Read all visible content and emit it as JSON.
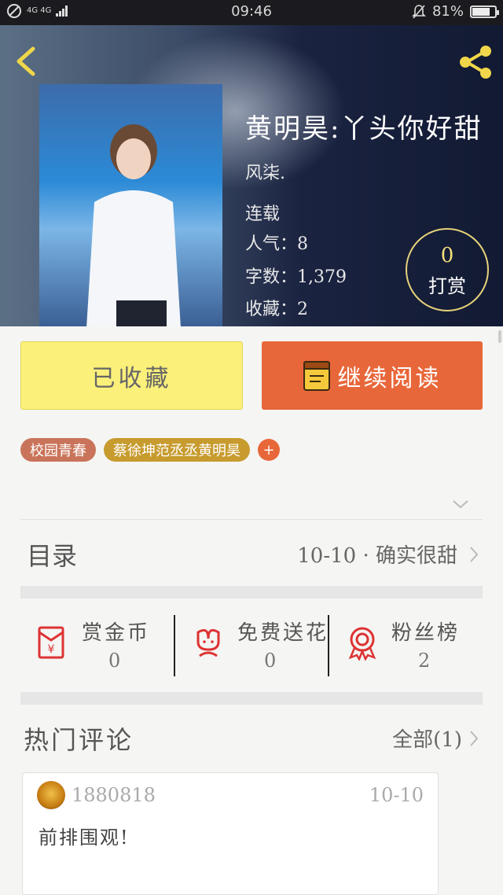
{
  "status_bar": {
    "network": "4G 4G",
    "time": "09:46",
    "battery": "81%",
    "battery_level": 0.81
  },
  "book": {
    "title": "黄明昊:丫头你好甜",
    "author": "风柒.",
    "status": "连载",
    "popularity": "人气：8",
    "word_count": "字数：1,379",
    "favorites": "收藏：2",
    "tip_count": "0",
    "tip_label": "打赏"
  },
  "actions": {
    "collected_label": "已收藏",
    "continue_label": "继续阅读"
  },
  "tags": {
    "items": [
      "校园青春",
      "蔡徐坤范丞丞黄明昊"
    ],
    "add": "+"
  },
  "catalog": {
    "label": "目录",
    "latest": "10-10 · 确实很甜"
  },
  "stats": {
    "gold": {
      "label": "赏金币",
      "value": "0"
    },
    "flowers": {
      "label": "免费送花",
      "value": "0"
    },
    "fans": {
      "label": "粉丝榜",
      "value": "2"
    }
  },
  "comments": {
    "title": "热门评论",
    "all_label": "全部(1)",
    "items": [
      {
        "user": "1880818",
        "date": "10-10",
        "text": "前排围观!"
      }
    ]
  },
  "colors": {
    "primary": "#e8673a",
    "collected": "#fbf07a",
    "tip_ring": "#e6d27a",
    "tag_campus": "#c9745a",
    "tag_names": "#c79b2e"
  }
}
